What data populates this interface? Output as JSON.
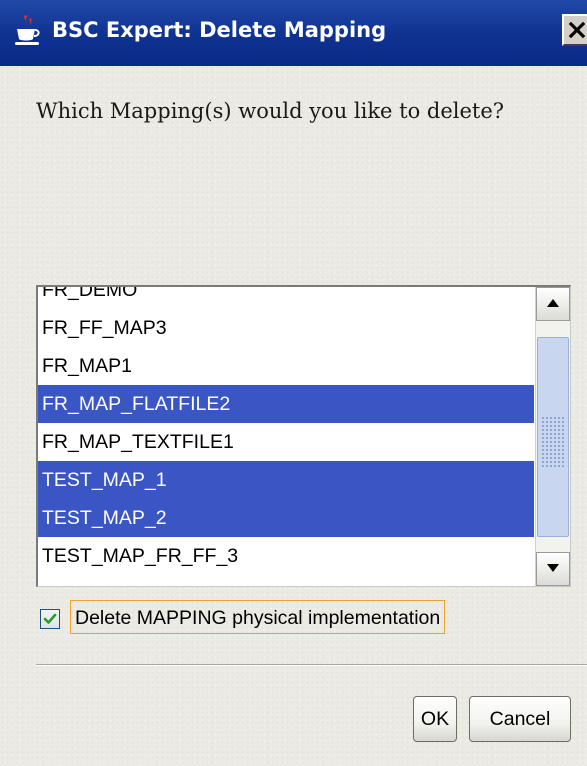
{
  "window": {
    "title": "BSC Expert: Delete Mapping"
  },
  "question": "Which Mapping(s) would you like to delete?",
  "mappings": [
    {
      "label": "FR_DEMO",
      "selected": false
    },
    {
      "label": "FR_FF_MAP3",
      "selected": false
    },
    {
      "label": "FR_MAP1",
      "selected": false
    },
    {
      "label": "FR_MAP_FLATFILE2",
      "selected": true
    },
    {
      "label": "FR_MAP_TEXTFILE1",
      "selected": false
    },
    {
      "label": "TEST_MAP_1",
      "selected": true
    },
    {
      "label": "TEST_MAP_2",
      "selected": true
    },
    {
      "label": "TEST_MAP_FR_FF_3",
      "selected": false
    }
  ],
  "checkbox": {
    "label": "Delete MAPPING physical implementation",
    "checked": true
  },
  "buttons": {
    "ok": "OK",
    "cancel": "Cancel"
  },
  "colors": {
    "titlebar": "#0f3190",
    "selection": "#3a56c4",
    "check_mark": "#21a121",
    "focus_border": "#f0a030"
  },
  "icons": {
    "app": "java-cup-icon",
    "close": "close-icon",
    "scroll_up": "arrow-up-icon",
    "scroll_down": "arrow-down-icon",
    "check": "checkmark-icon"
  }
}
